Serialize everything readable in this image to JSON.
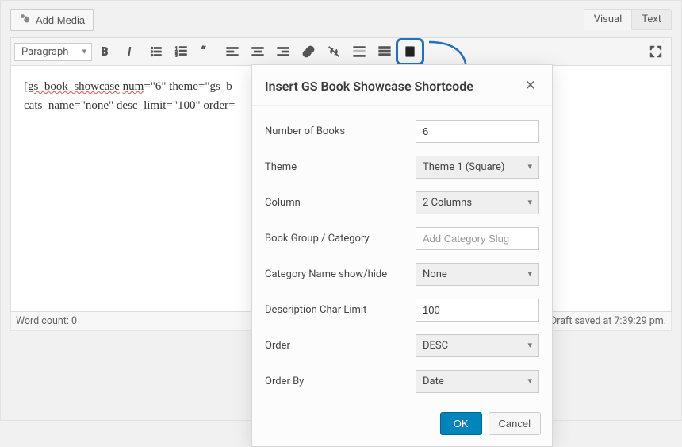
{
  "topbar": {
    "add_media": "Add Media",
    "tabs": {
      "visual": "Visual",
      "text": "Text"
    },
    "active_tab": "visual"
  },
  "toolbar": {
    "format_label": "Paragraph",
    "buttons": [
      "bold",
      "italic",
      "ul",
      "ol",
      "blockquote",
      "align-left",
      "align-center",
      "align-right",
      "link",
      "unlink",
      "readmore",
      "toggle-toolbar",
      "showcase"
    ]
  },
  "editor": {
    "line1_a": "[",
    "line1_b": "gs_book_showcase",
    "line1_c": " ",
    "line1_d": "num",
    "line1_e": "=\"6\" theme=\"gs_b",
    "line2": "cats_name=\"none\" desc_limit=\"100\" order="
  },
  "statusbar": {
    "word_count_label": "Word count: 0",
    "draft_saved": "Draft saved at 7:39:29 pm."
  },
  "dialog": {
    "title": "Insert GS Book Showcase Shortcode",
    "fields": {
      "num_books": {
        "label": "Number of Books",
        "value": "6"
      },
      "theme": {
        "label": "Theme",
        "value": "Theme 1 (Square)"
      },
      "column": {
        "label": "Column",
        "value": "2 Columns"
      },
      "category": {
        "label": "Book Group / Category",
        "placeholder": "Add Category Slug",
        "value": ""
      },
      "cat_show": {
        "label": "Category Name show/hide",
        "value": "None"
      },
      "desc_limit": {
        "label": "Description Char Limit",
        "value": "100"
      },
      "order": {
        "label": "Order",
        "value": "DESC"
      },
      "order_by": {
        "label": "Order By",
        "value": "Date"
      }
    },
    "ok": "OK",
    "cancel": "Cancel"
  }
}
